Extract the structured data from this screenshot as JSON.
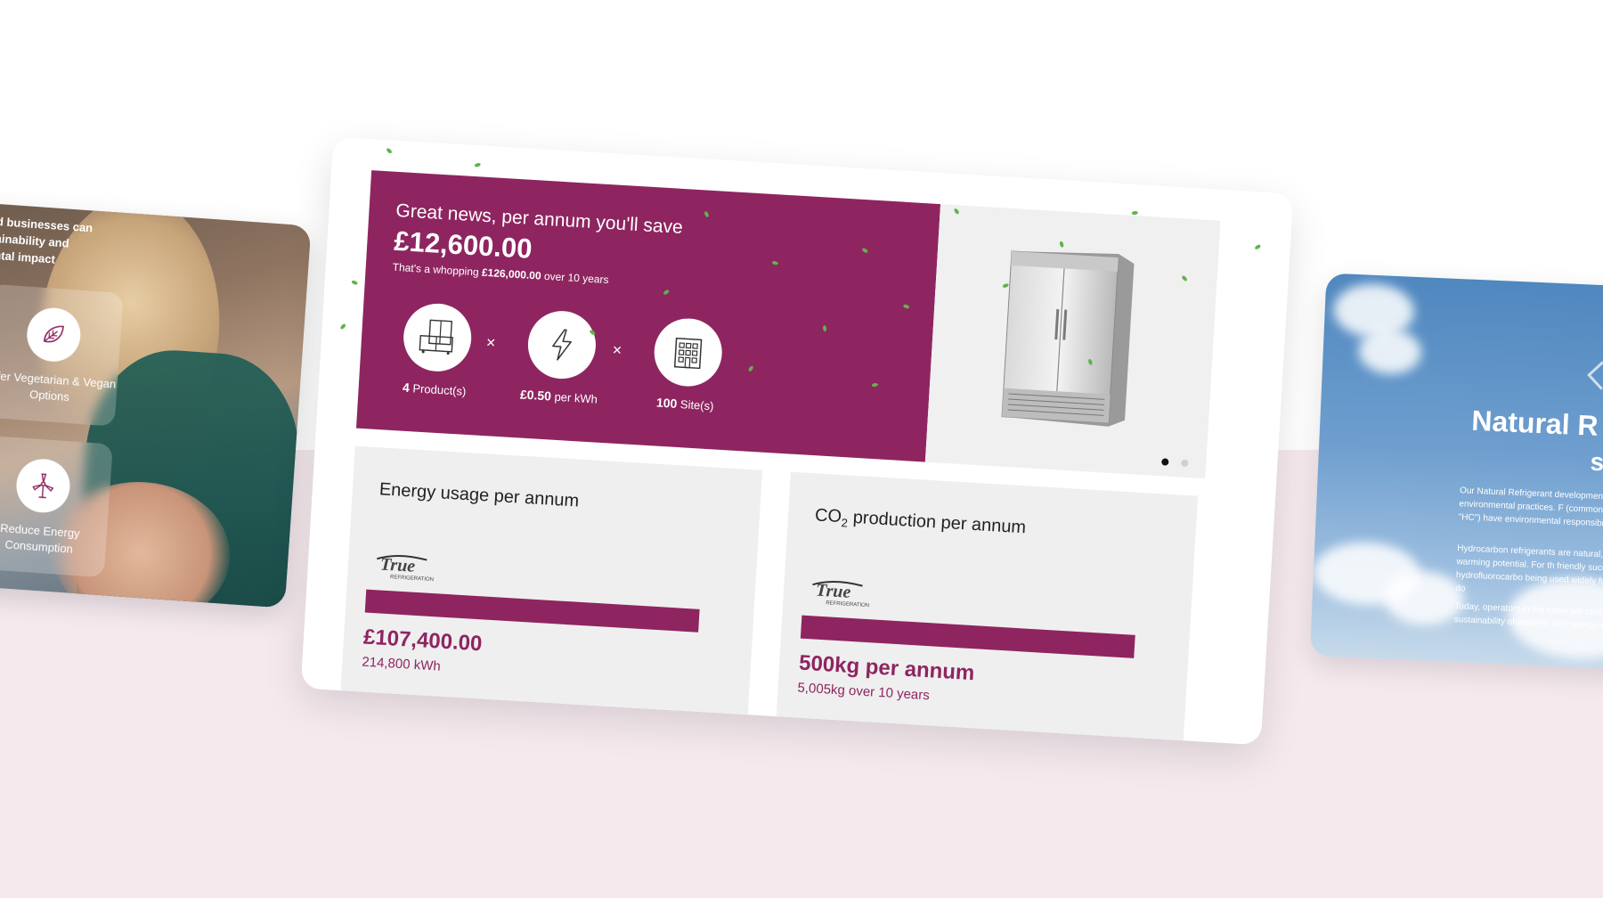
{
  "colors": {
    "brand": "#8e2560",
    "panel_grey": "#efefef",
    "band": "#f5e9ee"
  },
  "left_card": {
    "headline": "d businesses can\nainability and\nntal impact",
    "features": [
      {
        "icon": "leaf-icon",
        "label": "Offer Vegetarian & Vegan Options"
      },
      {
        "icon": "wind-turbine-icon",
        "label": "Reduce Energy Consumption"
      }
    ]
  },
  "savings": {
    "headline": "Great news, per annum you'll save",
    "amount": "£12,600.00",
    "sub_prefix": "That's a whopping",
    "sub_amount": "£126,000.00",
    "sub_suffix": "over 10 years",
    "calc": [
      {
        "icon": "fridge-icon",
        "value": "4",
        "unit": "Product(s)"
      },
      {
        "icon": "lightning-icon",
        "value": "£0.50",
        "unit": "per kWh"
      },
      {
        "icon": "building-icon",
        "value": "100",
        "unit": "Site(s)"
      }
    ],
    "operator": "×"
  },
  "product": {
    "image": "commercial-double-door-fridge",
    "carousel_active": 0,
    "carousel_count": 2
  },
  "energy": {
    "title": "Energy usage per annum",
    "logo": "True Refrigeration",
    "amount": "£107,400.00",
    "kwh": "214,800 kWh"
  },
  "co2": {
    "title_pre": "CO",
    "title_sub": "2",
    "title_post": " production per annum",
    "logo": "True Refrigeration",
    "amount": "500kg per annum",
    "sub": "5,005kg over 10 years"
  },
  "right_card": {
    "heading": "Natural R",
    "heading2": "s",
    "paragraphs": [
      "Our Natural Refrigerant development responsible environmental practices. F (commonly abbreviated as \"HC\") have environmental responsibility, but also",
      "Hydrocarbon refrigerants are natural, and low global warming potential. For th friendly successor to hydrofluorocarbo being used widely for many years in do",
      "Today, operators in the know are choosi corporate sustainability objectives, to in energy reduction."
    ]
  }
}
